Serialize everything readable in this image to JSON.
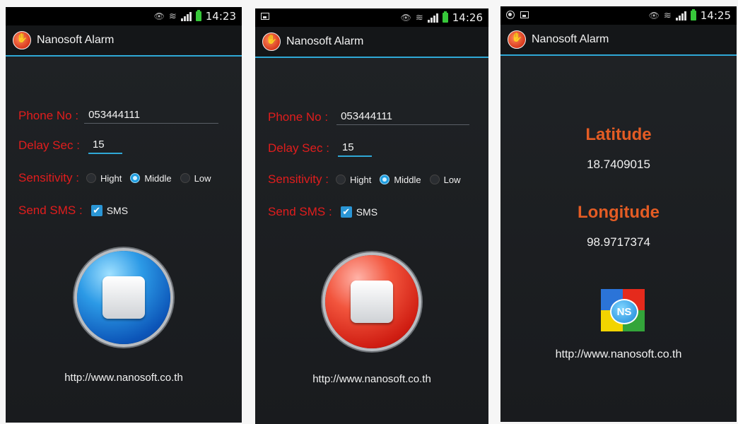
{
  "screens": [
    {
      "status": {
        "time": "14:23"
      },
      "title": "Nanosoft Alarm",
      "phone_label": "Phone No :",
      "phone_value": "053444111",
      "delay_label": "Delay Sec :",
      "delay_value": "15",
      "sensitivity_label": "Sensitivity :",
      "sensitivity_options": [
        "Hight",
        "Middle",
        "Low"
      ],
      "sensitivity_selected": "Middle",
      "sms_label": "Send SMS :",
      "sms_checkbox_label": "SMS",
      "sms_checked": true,
      "stop_button_color": "#1e7fd8",
      "url": "http://www.nanosoft.co.th"
    },
    {
      "status": {
        "time": "14:26"
      },
      "title": "Nanosoft Alarm",
      "phone_label": "Phone No :",
      "phone_value": "053444111",
      "delay_label": "Delay Sec :",
      "delay_value": "15",
      "sensitivity_label": "Sensitivity :",
      "sensitivity_options": [
        "Hight",
        "Middle",
        "Low"
      ],
      "sensitivity_selected": "Middle",
      "sms_label": "Send SMS :",
      "sms_checkbox_label": "SMS",
      "sms_checked": true,
      "stop_button_color": "#e0281a",
      "url": "http://www.nanosoft.co.th"
    },
    {
      "status": {
        "time": "14:25"
      },
      "title": "Nanosoft Alarm",
      "latitude_label": "Latitude",
      "latitude_value": "18.7409015",
      "longitude_label": "Longitude",
      "longitude_value": "98.9717374",
      "logo_text": "NS",
      "url": "http://www.nanosoft.co.th"
    }
  ],
  "colors": {
    "label_red": "#e11d1d",
    "accent_blue": "#2fa8d6",
    "location_orange": "#e45c24"
  }
}
